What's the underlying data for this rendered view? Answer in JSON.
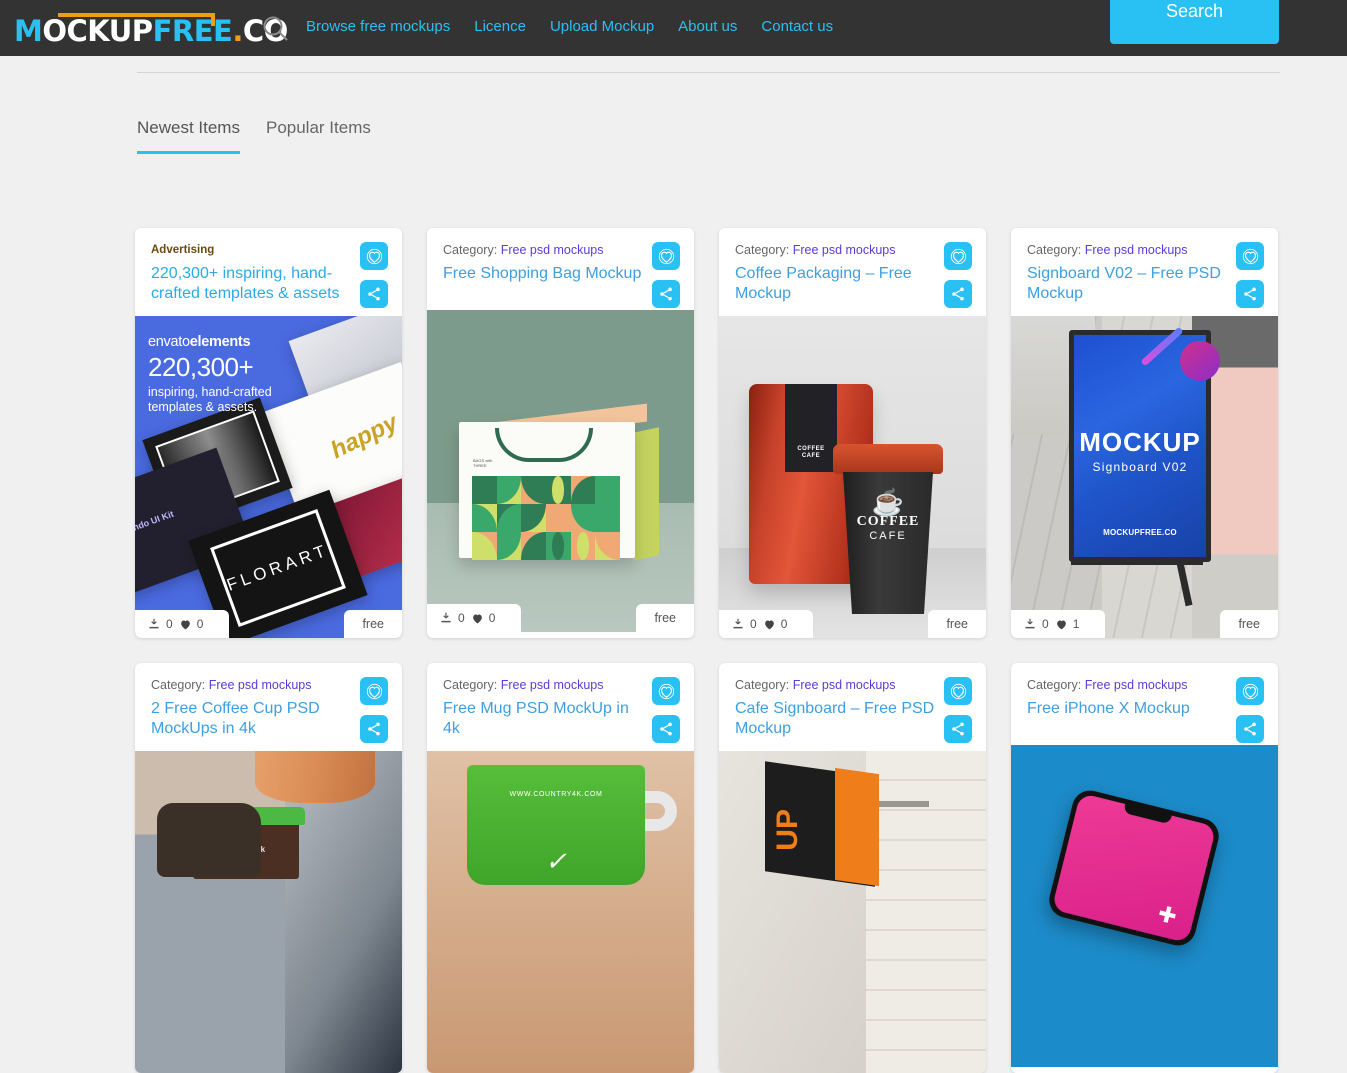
{
  "header": {
    "logo": {
      "m": "M",
      "ockup": "OCKUP",
      "free": "FREE",
      "dot": ".",
      "co": "CO"
    },
    "search_icon": "search-icon",
    "nav": [
      {
        "label": "Browse free mockups"
      },
      {
        "label": "Licence"
      },
      {
        "label": "Upload Mockup"
      },
      {
        "label": "About us"
      },
      {
        "label": "Contact us"
      }
    ],
    "search_button": "Search"
  },
  "tabs": [
    {
      "label": "Newest Items",
      "active": true
    },
    {
      "label": "Popular Items",
      "active": false
    }
  ],
  "colors": {
    "accent": "#29c0f4",
    "header_bg": "#333333",
    "page_bg": "#f0f0f0",
    "title_link": "#3d9fe0",
    "category_link": "#5a3cd6",
    "ad_label": "#6b4a12"
  },
  "cards": [
    {
      "is_ad": true,
      "category_label": "Advertising",
      "category_link": "",
      "title": "220,300+ inspiring, hand-crafted templates & assets",
      "downloads": "0",
      "likes": "0",
      "price": "free",
      "art": "envato-ad",
      "ad_art": {
        "brand_light": "envato",
        "brand_bold": "elements",
        "number": "220,300+",
        "subtitle": "inspiring, hand-crafted templates & assets.",
        "thumb_labels": [
          "FLORART",
          "Lando UI Kit",
          "happy"
        ]
      }
    },
    {
      "is_ad": false,
      "category_label": "Category:",
      "category_link": "Free psd mockups",
      "title": "Free Shopping Bag Mockup",
      "downloads": "0",
      "likes": "0",
      "price": "free",
      "art": "shopping-bag"
    },
    {
      "is_ad": false,
      "category_label": "Category:",
      "category_link": "Free psd mockups",
      "title": "Coffee Packaging – Free Mockup",
      "downloads": "0",
      "likes": "0",
      "price": "free",
      "art": "coffee-packaging",
      "art_text": {
        "line1": "COFFEE",
        "line2": "CAFE"
      }
    },
    {
      "is_ad": false,
      "category_label": "Category:",
      "category_link": "Free psd mockups",
      "title": "Signboard V02 – Free PSD Mockup",
      "downloads": "0",
      "likes": "1",
      "price": "free",
      "art": "signboard",
      "art_text": {
        "line1": "MOCKUP",
        "line2": "Signboard V02",
        "brand": "MOCKUPFREE.CO"
      }
    },
    {
      "is_ad": false,
      "category_label": "Category:",
      "category_link": "Free psd mockups",
      "title": "2 Free Coffee Cup PSD MockUps in 4k",
      "art": "coffee-cup-hand",
      "art_text": {
        "brand": "country4k"
      }
    },
    {
      "is_ad": false,
      "category_label": "Category:",
      "category_link": "Free psd mockups",
      "title": "Free Mug PSD MockUp in 4k",
      "art": "green-mug",
      "art_text": {
        "url": "WWW.COUNTRY4K.COM"
      }
    },
    {
      "is_ad": false,
      "category_label": "Category:",
      "category_link": "Free psd mockups",
      "title": "Cafe Signboard – Free PSD Mockup",
      "art": "cafe-signboard"
    },
    {
      "is_ad": false,
      "category_label": "Category:",
      "category_link": "Free psd mockups",
      "title": "Free iPhone X Mockup",
      "art": "iphone-x"
    }
  ],
  "icons": {
    "favorite": "heart-icon",
    "share": "share-icon",
    "download": "download-icon",
    "likes": "heart-filled-icon"
  }
}
